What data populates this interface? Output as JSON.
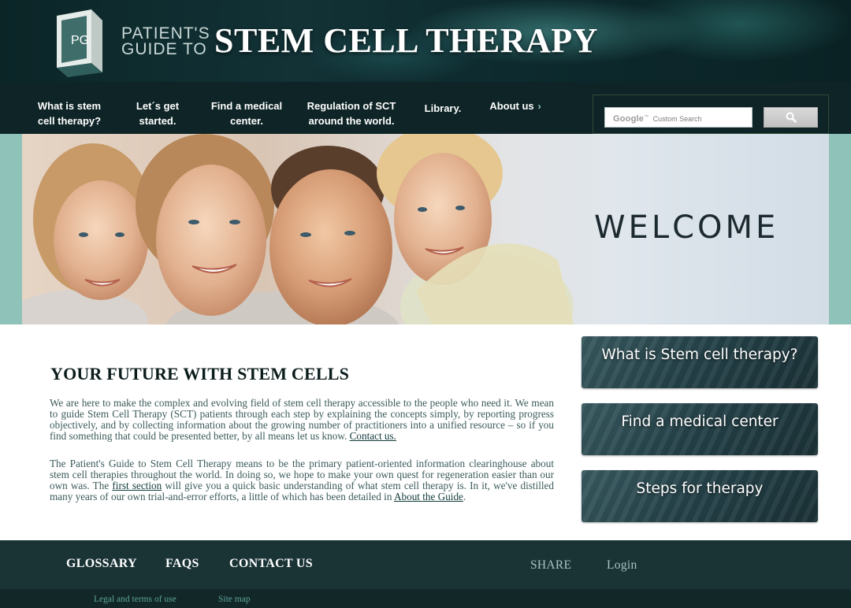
{
  "header": {
    "brand_small_line1": "PATIENT'S",
    "brand_small_line2": "GUIDE TO",
    "brand_big": "STEM CELL THERAPY",
    "logo_letters": "PG"
  },
  "nav": {
    "items": [
      {
        "line1": "What is stem",
        "line2": "cell therapy?"
      },
      {
        "line1": "Let´s get",
        "line2": "started."
      },
      {
        "line1": "Find a medical",
        "line2": "center."
      },
      {
        "line1": "Regulation of SCT",
        "line2": "around the world."
      },
      {
        "line1": "Library.",
        "line2": ""
      },
      {
        "line1": "About us",
        "line2": ""
      }
    ],
    "about_chevron": "›"
  },
  "search": {
    "google_label": "Google",
    "tm": "™",
    "placeholder_text": "Custom Search"
  },
  "hero": {
    "welcome": "WELCOME"
  },
  "main": {
    "title": "YOUR FUTURE WITH STEM CELLS",
    "p1_text": "We are here to make the complex and evolving field of stem cell therapy accessible to the people who need it. We mean to guide Stem Cell Therapy (SCT) patients through each step by explaining the concepts simply, by reporting progress objectively, and by collecting information about the growing number of practitioners into a unified resource – so if you find something that could be presented better, by all means let us know.",
    "p1_link": "Contact us.",
    "p2_text_a": "The Patient's Guide to Stem Cell Therapy means to be the primary patient-oriented information clearinghouse about stem cell therapies throughout the world. In doing so, we hope to make your own quest for regeneration easier than our own was. The",
    "p2_link1": "first section",
    "p2_text_b": "will give you a quick basic understanding of what stem cell therapy is. In it, we've distilled many years of our own trial-and-error efforts, a little of which has been detailed in",
    "p2_link2": "About the Guide",
    "p2_text_c": "."
  },
  "sidebar": {
    "cards": [
      {
        "label": "What is Stem cell therapy?"
      },
      {
        "label": "Find a medical center"
      },
      {
        "label": "Steps for therapy"
      }
    ]
  },
  "footer": {
    "links": [
      "GLOSSARY",
      "FAQS",
      "CONTACT US"
    ],
    "share": "SHARE",
    "login": "Login",
    "legal": "Legal and terms of use",
    "sitemap": "Site map"
  },
  "colors": {
    "header_bg": "#0b2527",
    "nav_bg": "#0e2426",
    "hero_band": "#8fc3b9",
    "footer_bg": "#1a3335",
    "text_body": "#3c5a5a"
  }
}
